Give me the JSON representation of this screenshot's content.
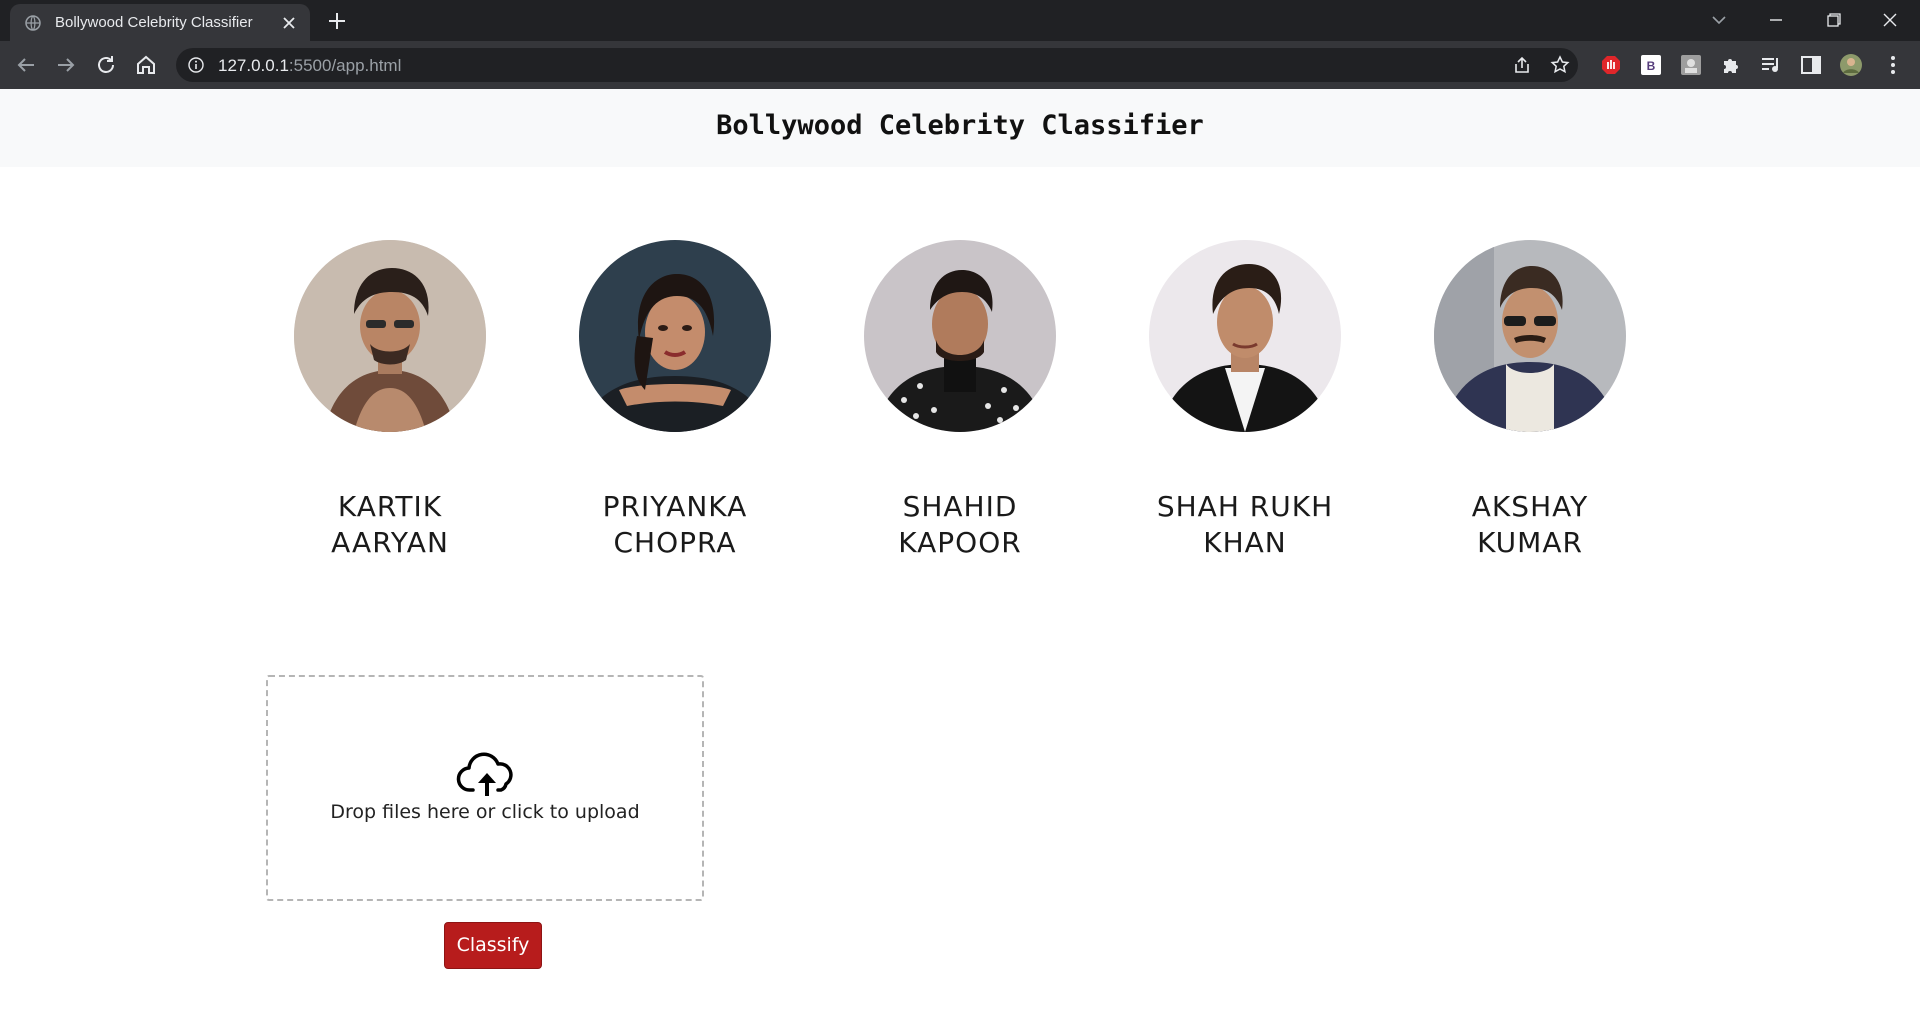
{
  "browser": {
    "tab_title": "Bollywood Celebrity Classifier",
    "url_host": "127.0.0.1",
    "url_rest": ":5500/app.html"
  },
  "header": {
    "title": "Bollywood Celebrity Classifier"
  },
  "celebrities": [
    {
      "name_line1": "KARTIK",
      "name_line2": "AARYAN"
    },
    {
      "name_line1": "PRIYANKA",
      "name_line2": "CHOPRA"
    },
    {
      "name_line1": "SHAHID",
      "name_line2": "KAPOOR"
    },
    {
      "name_line1": "SHAH RUKH",
      "name_line2": "KHAN"
    },
    {
      "name_line1": "AKSHAY",
      "name_line2": "KUMAR"
    }
  ],
  "upload": {
    "prompt": "Drop files here or click to upload",
    "icon": "cloud-upload-icon"
  },
  "actions": {
    "classify_label": "Classify"
  },
  "colors": {
    "classify_button": "#b71c1c",
    "navbar_bg": "#f8f9fa",
    "browser_frame": "#202124"
  }
}
